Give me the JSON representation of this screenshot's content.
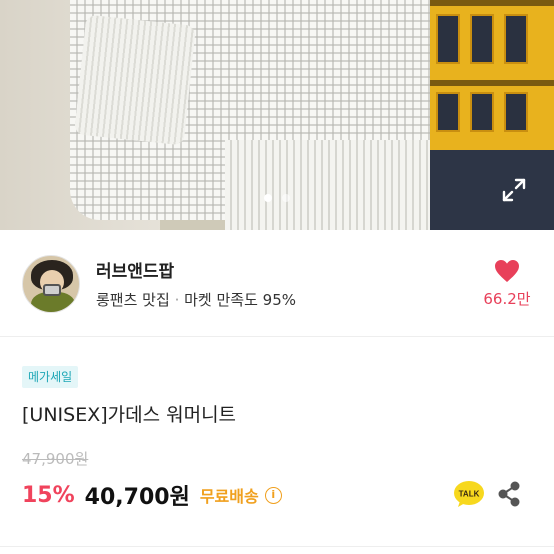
{
  "hero": {
    "image_alt": "",
    "slide_dots": [
      true,
      false
    ],
    "expand_icon": "expand-icon"
  },
  "seller": {
    "name": "러브앤드팝",
    "tagline": "롱팬츠 맛집",
    "separator": "·",
    "satisfaction": "마켓 만족도 95%",
    "like_count": "66.2만",
    "heart_color": "#e8405a"
  },
  "product": {
    "badge": "메가세일",
    "title": "[UNISEX]가데스 워머니트",
    "original_price": "47,900원",
    "discount": "15%",
    "price": "40,700원",
    "shipping": "무료배송",
    "info_symbol": "i"
  },
  "actions": {
    "talk_label": "TALK",
    "share_icon": "share-icon"
  },
  "colors": {
    "discount": "#f0435c",
    "shipping": "#f0a01e",
    "badge_text": "#1ea7b6",
    "badge_bg": "#e4f6f8"
  }
}
